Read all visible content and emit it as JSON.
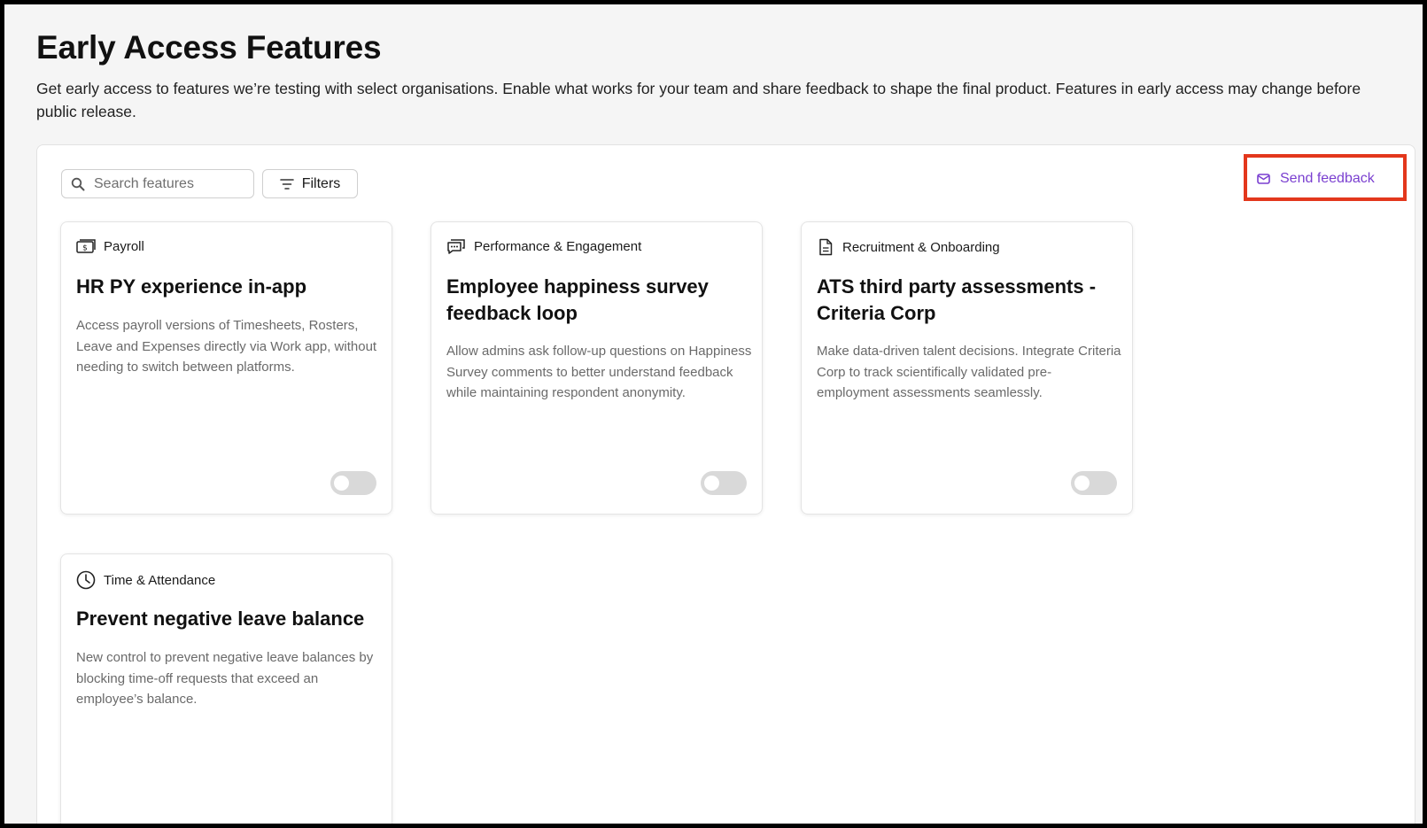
{
  "header": {
    "title": "Early Access Features",
    "description": "Get early access to features we’re testing with select organisations. Enable what works for your team and share feedback to shape the final product. Features in early access may change before public release."
  },
  "toolbar": {
    "search_placeholder": "Search features",
    "filters_label": "Filters",
    "send_feedback_label": "Send feedback"
  },
  "cards": [
    {
      "category": "Payroll",
      "category_icon": "money-icon",
      "title": "HR PY experience in-app",
      "description": "Access payroll versions of Timesheets, Rosters, Leave and Expenses directly via Work app, without needing to switch between platforms.",
      "enabled": false
    },
    {
      "category": "Performance & Engagement",
      "category_icon": "chat-bubbles-icon",
      "title": "Employee happiness survey feedback loop",
      "description": "Allow admins ask follow-up questions on Happiness Survey comments to better understand feedback while maintaining respondent anonymity.",
      "enabled": false
    },
    {
      "category": "Recruitment & Onboarding",
      "category_icon": "document-icon",
      "title": "ATS third party assessments - Criteria Corp",
      "description": "Make data-driven talent decisions. Integrate Criteria Corp to track scientifically validated pre-employment assessments seamlessly.",
      "enabled": false
    },
    {
      "category": "Time & Attendance",
      "category_icon": "clock-icon",
      "title": "Prevent negative leave balance",
      "description": "New control to prevent negative leave balances by blocking time-off requests that exceed an employee’s balance.",
      "enabled": false
    }
  ],
  "colors": {
    "accent": "#7a3fd0",
    "highlight_border": "#e3371c",
    "toggle_off": "#d9d9d9"
  }
}
